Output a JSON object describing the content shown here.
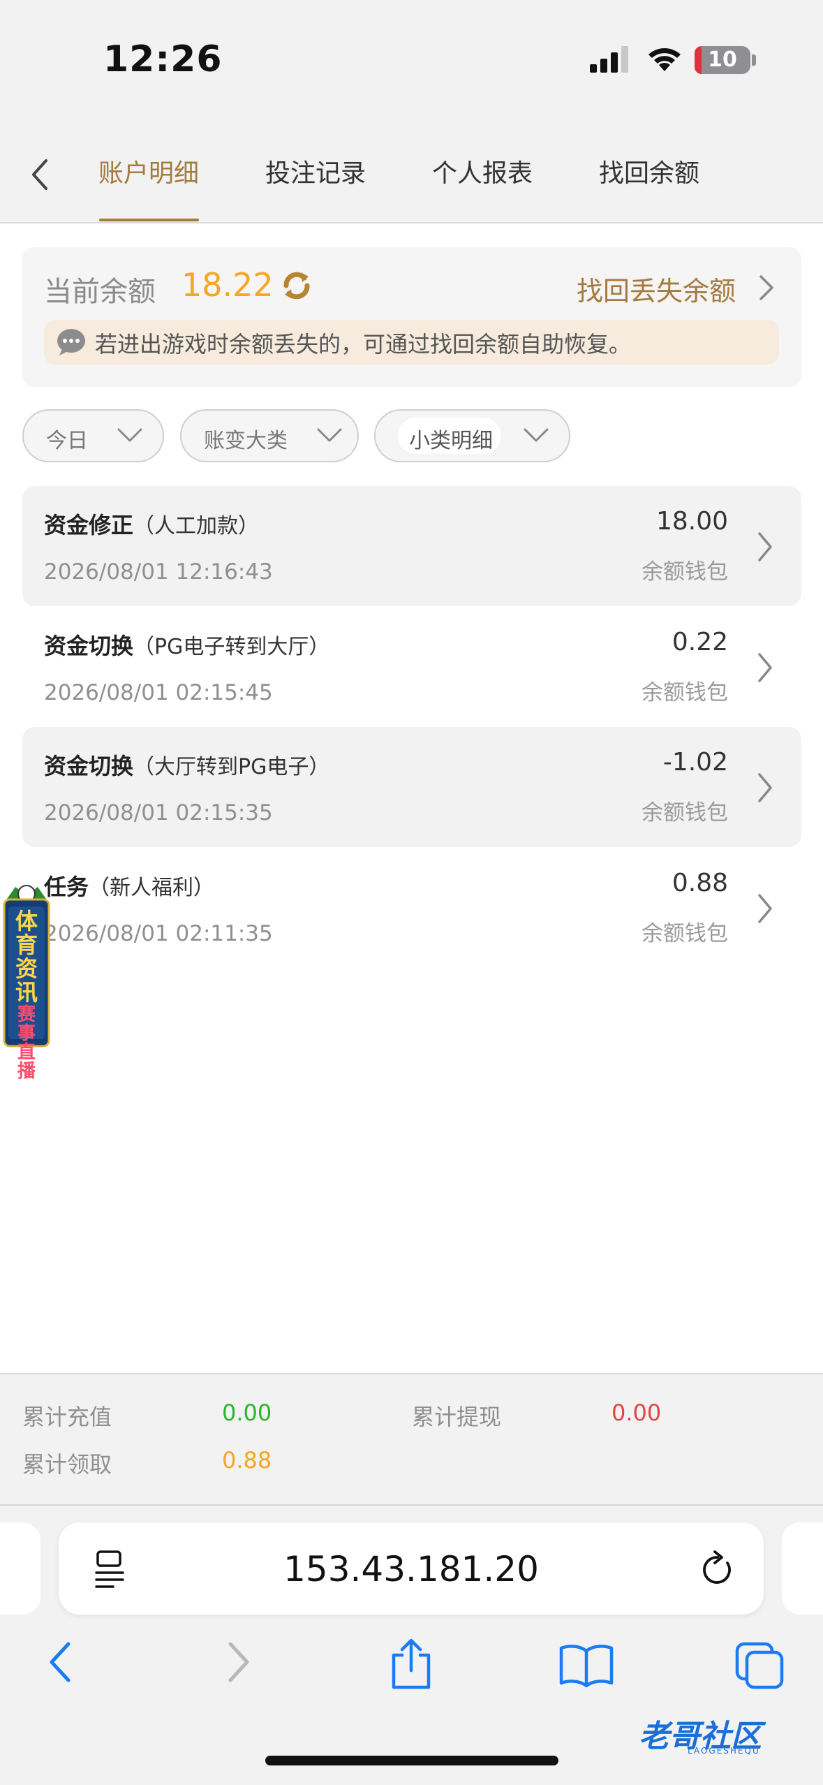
{
  "status_bar": {
    "time": "12:26",
    "battery": "10"
  },
  "tabs": [
    {
      "label": "账户明细",
      "active": true
    },
    {
      "label": "投注记录",
      "active": false
    },
    {
      "label": "个人报表",
      "active": false
    },
    {
      "label": "找回余额",
      "active": false
    }
  ],
  "balance": {
    "label": "当前余额",
    "value": "18.22",
    "recover_link": "找回丢失余额",
    "notice": "若进出游戏时余额丢失的，可通过找回余额自助恢复。"
  },
  "filters": [
    {
      "label": "今日"
    },
    {
      "label": "账变大类"
    },
    {
      "label": "小类明细"
    }
  ],
  "records": [
    {
      "title": "资金修正",
      "sub": "（人工加款）",
      "time": "2026/08/01 12:16:43",
      "amount": "18.00",
      "wallet": "余额钱包"
    },
    {
      "title": "资金切换",
      "sub": "（PG电子转到大厅）",
      "time": "2026/08/01 02:15:45",
      "amount": "0.22",
      "wallet": "余额钱包"
    },
    {
      "title": "资金切换",
      "sub": "（大厅转到PG电子）",
      "time": "2026/08/01 02:15:35",
      "amount": "-1.02",
      "wallet": "余额钱包"
    },
    {
      "title": "任务",
      "sub": "（新人福利）",
      "time": "2026/08/01 02:11:35",
      "amount": "0.88",
      "wallet": "余额钱包"
    }
  ],
  "ad_banner": {
    "line1": "体育资讯",
    "line2": "赛事直播"
  },
  "summary": {
    "recharge_label": "累计充值",
    "recharge_value": "0.00",
    "withdraw_label": "累计提现",
    "withdraw_value": "0.00",
    "claim_label": "累计领取",
    "claim_value": "0.88"
  },
  "browser": {
    "url": "153.43.181.20"
  },
  "watermark": {
    "text": "老哥社区",
    "sub": "LAOGESHEQU"
  },
  "colors": {
    "accent": "#a37a3f",
    "balance": "#f5a623",
    "green": "#2bb52b",
    "red": "#e04646",
    "ios_blue": "#1a7cf5"
  }
}
